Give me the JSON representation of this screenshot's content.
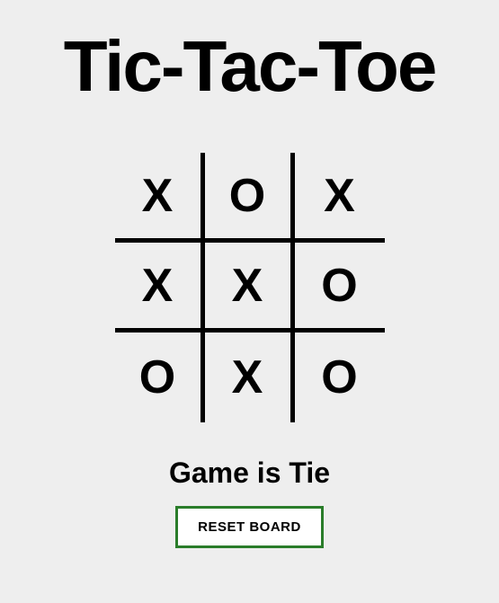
{
  "title": "Tic-Tac-Toe",
  "board": {
    "cells": [
      "X",
      "O",
      "X",
      "X",
      "X",
      "O",
      "O",
      "X",
      "O"
    ]
  },
  "status": "Game is Tie",
  "reset_label": "RESET BOARD",
  "colors": {
    "background": "#eeeeee",
    "text": "#000000",
    "button_border": "#2a7d2a",
    "button_bg": "#ffffff"
  }
}
